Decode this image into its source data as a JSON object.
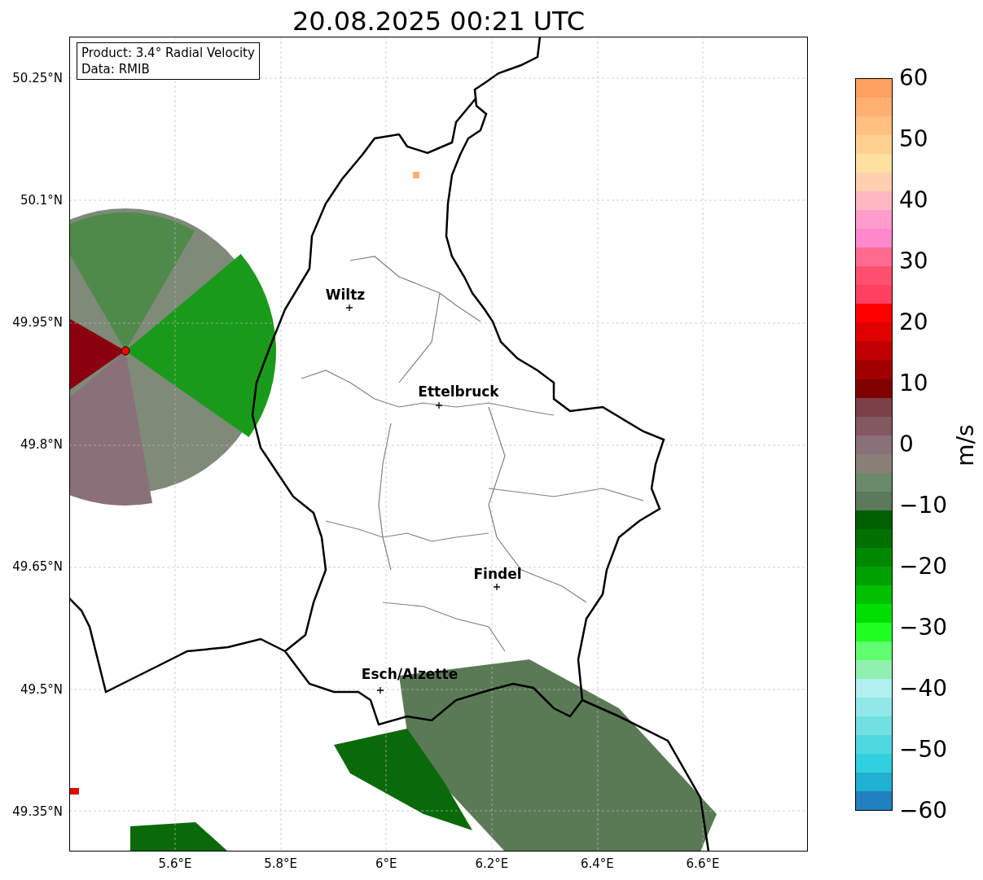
{
  "title": "20.08.2025 00:21 UTC",
  "info_box": [
    "Product: 3.4° Radial Velocity",
    "Data: RMIB"
  ],
  "cities": [
    {
      "name": "Wiltz"
    },
    {
      "name": "Ettelbruck"
    },
    {
      "name": "Findel"
    },
    {
      "name": "Esch/Alzette"
    }
  ],
  "y_ticks": [
    "50.25°N",
    "50.1°N",
    "49.95°N",
    "49.8°N",
    "49.65°N",
    "49.5°N",
    "49.35°N"
  ],
  "x_ticks": [
    "5.6°E",
    "5.8°E",
    "6°E",
    "6.2°E",
    "6.4°E",
    "6.6°E"
  ],
  "colorbar": {
    "label": "m/s",
    "ticks": [
      "60",
      "50",
      "40",
      "30",
      "20",
      "10",
      "0",
      "−10",
      "−20",
      "−30",
      "−40",
      "−50",
      "−60"
    ]
  }
}
